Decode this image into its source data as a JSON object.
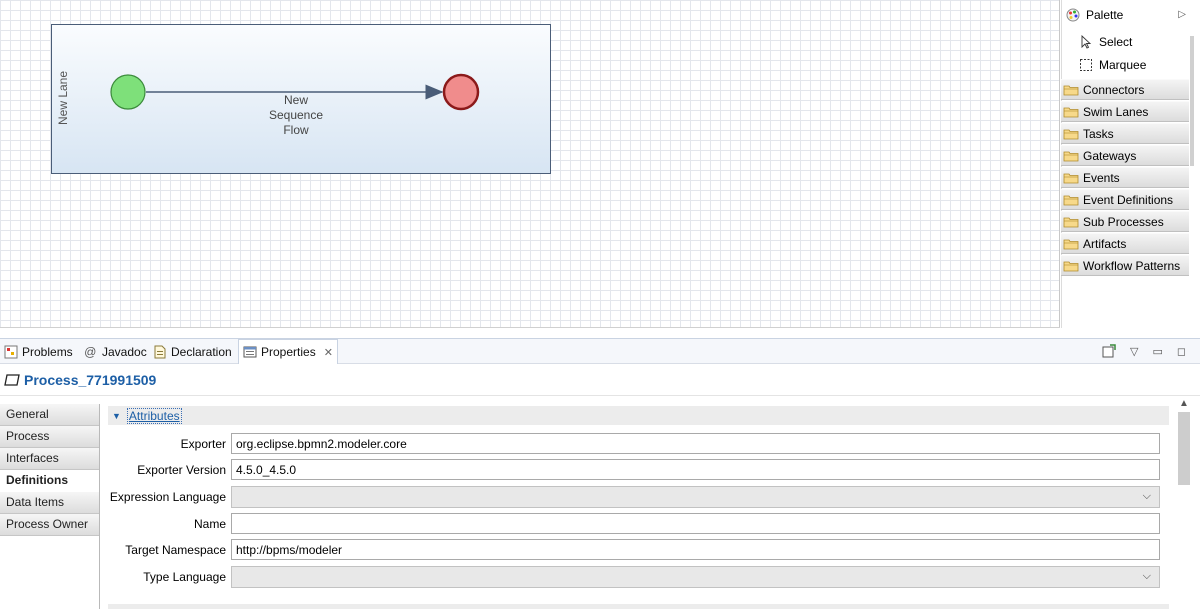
{
  "canvas": {
    "lane_label": "New Lane",
    "flow_label_lines": [
      "New",
      "Sequence",
      "Flow"
    ]
  },
  "palette": {
    "title": "Palette",
    "tools": [
      {
        "label": "Select",
        "icon": "select-arrow-icon"
      },
      {
        "label": "Marquee",
        "icon": "marquee-icon"
      }
    ],
    "drawers": [
      "Connectors",
      "Swim Lanes",
      "Tasks",
      "Gateways",
      "Events",
      "Event Definitions",
      "Sub Processes",
      "Artifacts",
      "Workflow Patterns"
    ]
  },
  "tabs": [
    {
      "label": "Problems",
      "icon": "problems-icon"
    },
    {
      "label": "Javadoc",
      "icon": "javadoc-icon"
    },
    {
      "label": "Declaration",
      "icon": "declaration-icon"
    },
    {
      "label": "Properties",
      "icon": "properties-icon",
      "active": true
    }
  ],
  "properties": {
    "title": "Process_771991509",
    "side_tabs": [
      "General",
      "Process",
      "Interfaces",
      "Definitions",
      "Data Items",
      "Process Owner"
    ],
    "selected_side_tab": "Definitions",
    "section": "Attributes",
    "fields": [
      {
        "label": "Exporter",
        "value": "org.eclipse.bpmn2.modeler.core",
        "type": "text"
      },
      {
        "label": "Exporter Version",
        "value": "4.5.0_4.5.0",
        "type": "text"
      },
      {
        "label": "Expression Language",
        "value": "",
        "type": "combo"
      },
      {
        "label": "Name",
        "value": "",
        "type": "text"
      },
      {
        "label": "Target Namespace",
        "value": "http://bpms/modeler",
        "type": "text"
      },
      {
        "label": "Type Language",
        "value": "",
        "type": "combo"
      }
    ]
  },
  "colors": {
    "start_event_fill": "#7ee07a",
    "end_event_fill": "#f08c8c",
    "end_event_stroke": "#8b1a1a",
    "accent": "#1d5fa6"
  }
}
